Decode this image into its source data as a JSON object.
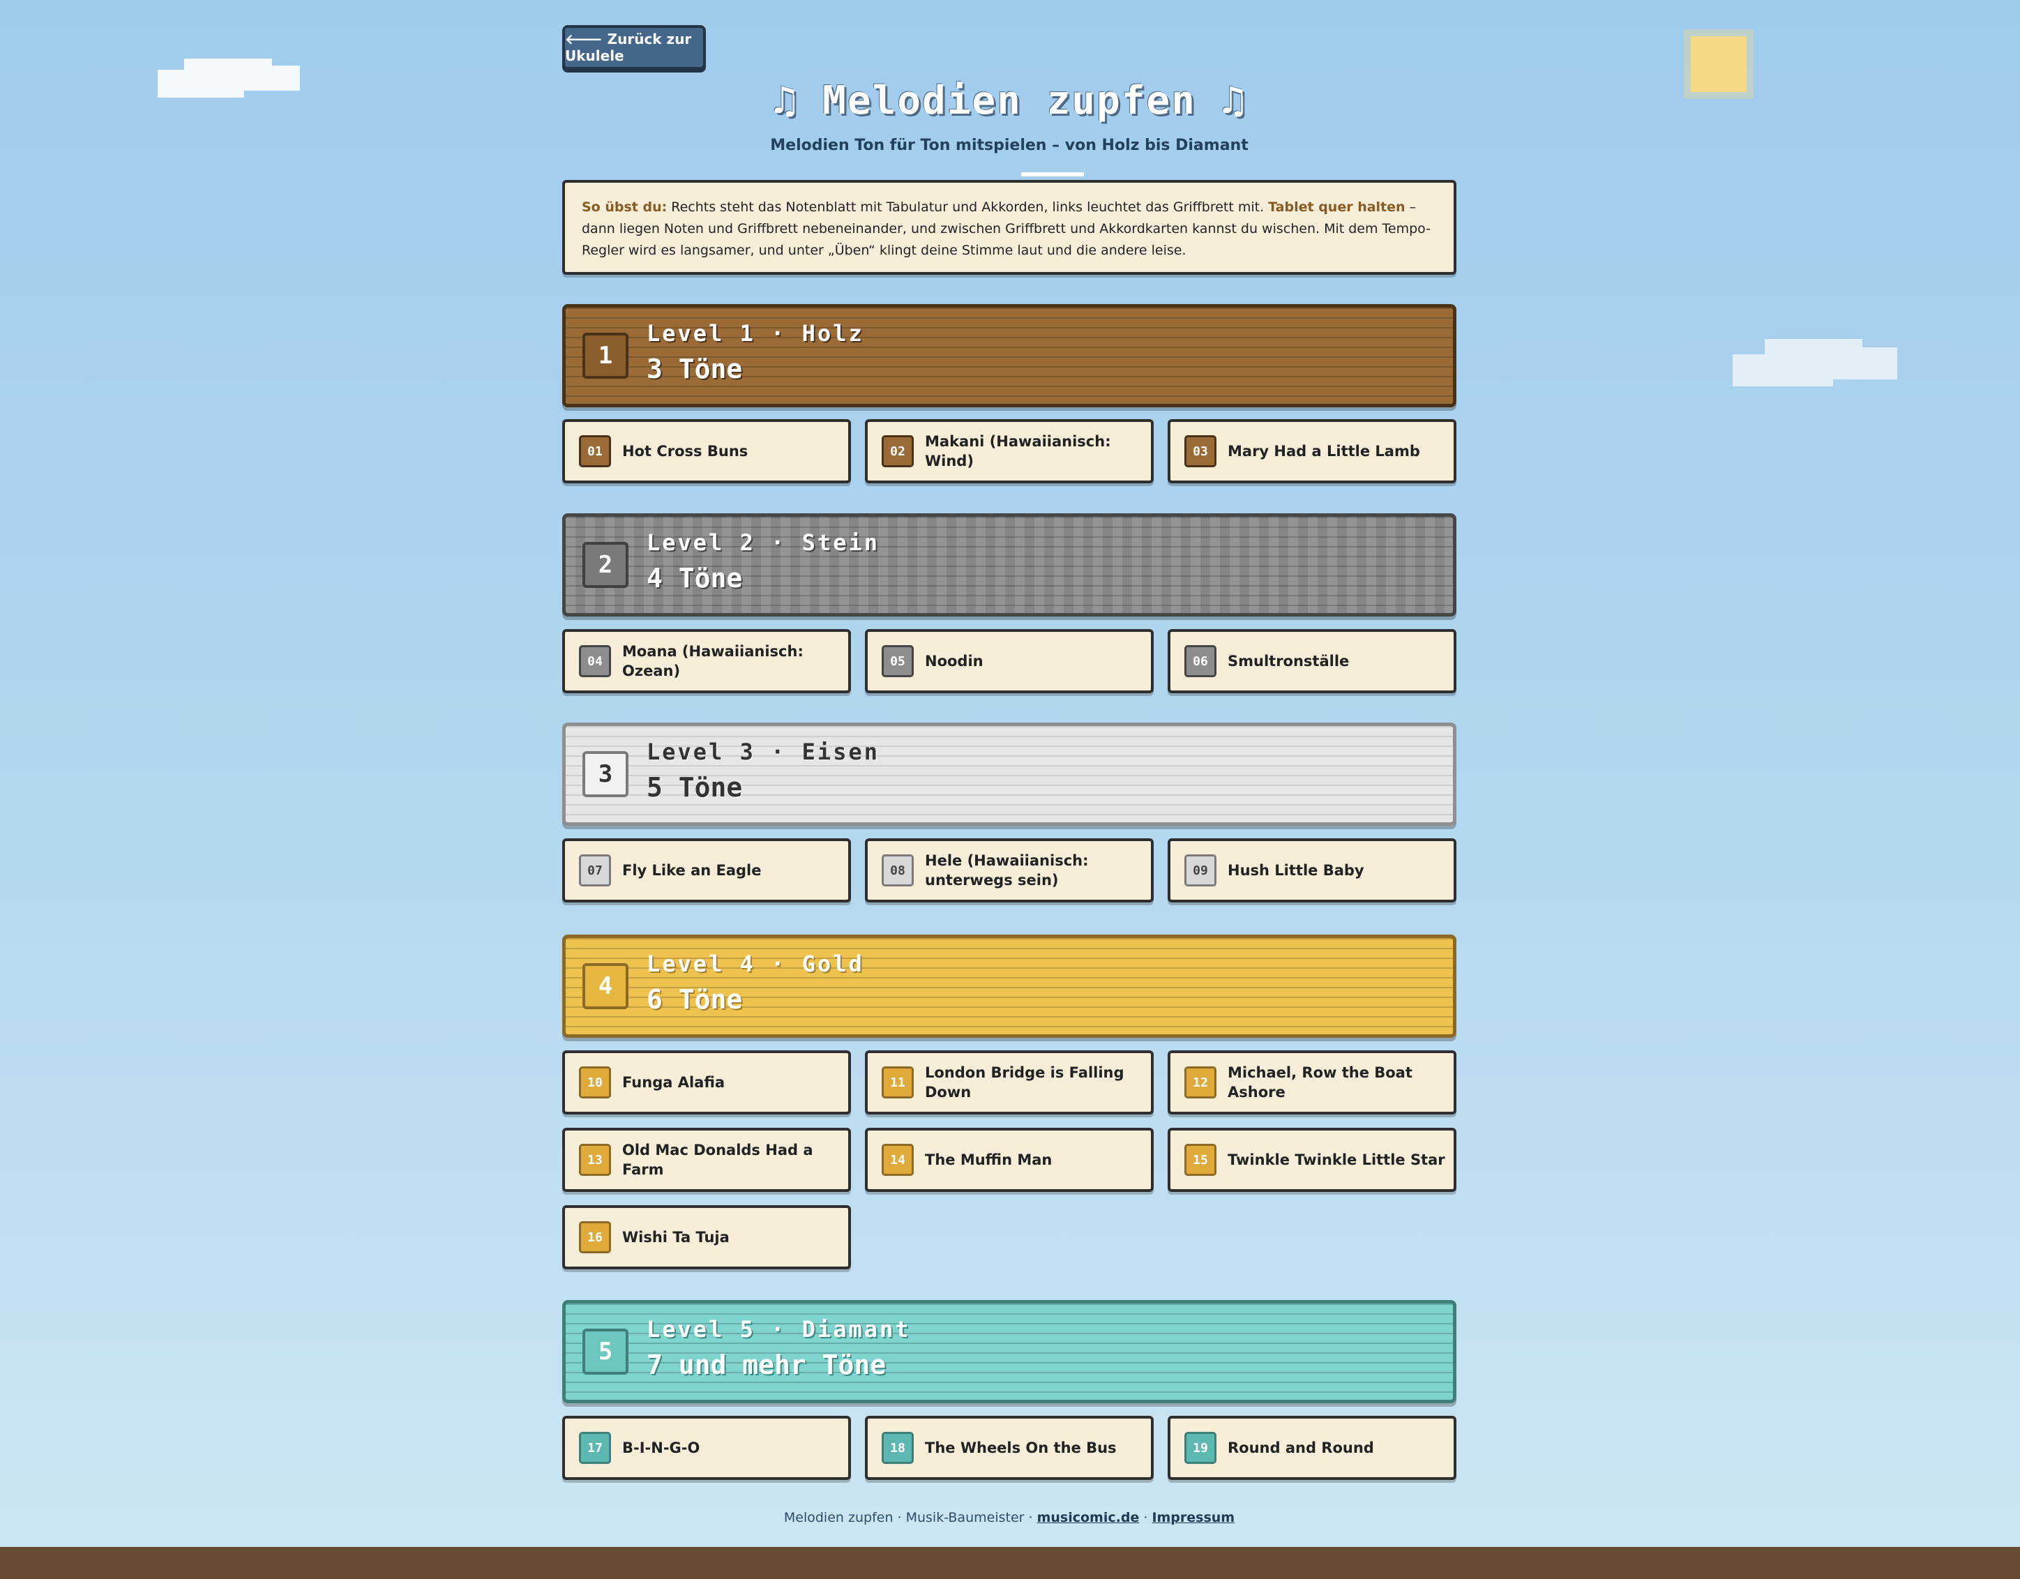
{
  "nav": {
    "back_label": "🡐 Zurück zur Ukulele"
  },
  "header": {
    "title": "♫ Melodien zupfen ♫",
    "subtitle": "Melodien Ton für Ton mitspielen – von Holz bis Diamant"
  },
  "info": {
    "lead": "So übst du:",
    "text1": " Rechts steht das Notenblatt mit Tabulatur und Akkorden, links leuchtet das Griffbrett mit. ",
    "highlight": "Tablet quer halten",
    "text2": " – dann liegen Noten und Griffbrett nebeneinander, und zwischen Griffbrett und Akkordkarten kannst du wischen. Mit dem Tempo-Regler wird es langsamer, und unter „Üben“ klingt deine Stimme laut und die andere leise."
  },
  "levels": [
    {
      "badge": "1",
      "title": "Level 1 · Holz",
      "tones": "3 Töne"
    },
    {
      "badge": "2",
      "title": "Level 2 · Stein",
      "tones": "4 Töne"
    },
    {
      "badge": "3",
      "title": "Level 3 · Eisen",
      "tones": "5 Töne"
    },
    {
      "badge": "4",
      "title": "Level 4 · Gold",
      "tones": "6 Töne"
    },
    {
      "badge": "5",
      "title": "Level 5 · Diamant",
      "tones": "7 und mehr Töne"
    }
  ],
  "songs": [
    {
      "num": "01",
      "name": "Hot Cross Buns"
    },
    {
      "num": "02",
      "name": "Makani (Hawaiianisch: Wind)"
    },
    {
      "num": "03",
      "name": "Mary Had a Little Lamb"
    },
    {
      "num": "04",
      "name": "Moana (Hawaiianisch: Ozean)"
    },
    {
      "num": "05",
      "name": "Noodin"
    },
    {
      "num": "06",
      "name": "Smultronställe"
    },
    {
      "num": "07",
      "name": "Fly Like an Eagle"
    },
    {
      "num": "08",
      "name": "Hele (Hawaiianisch: unterwegs sein)"
    },
    {
      "num": "09",
      "name": "Hush Little Baby"
    },
    {
      "num": "10",
      "name": "Funga Alafia"
    },
    {
      "num": "11",
      "name": "London Bridge is Falling Down"
    },
    {
      "num": "12",
      "name": "Michael, Row the Boat Ashore"
    },
    {
      "num": "13",
      "name": "Old Mac Donalds Had a Farm"
    },
    {
      "num": "14",
      "name": "The Muffin Man"
    },
    {
      "num": "15",
      "name": "Twinkle Twinkle Little Star"
    },
    {
      "num": "16",
      "name": "Wishi Ta Tuja"
    },
    {
      "num": "17",
      "name": "B-I-N-G-O"
    },
    {
      "num": "18",
      "name": "The Wheels On the Bus"
    },
    {
      "num": "19",
      "name": "Round and Round"
    }
  ],
  "footer": {
    "text": "Melodien zupfen · Musik-Baumeister · ",
    "link1": "musicomic.de",
    "sep": " · ",
    "link2": "Impressum"
  },
  "colors": {
    "sky_top": "#9fcbed",
    "wood": "#9a6b37",
    "stone": "#8d8d8d",
    "iron": "#e6e6e6",
    "gold": "#eec24f",
    "diamond": "#7fd4cd",
    "card": "#f6eed9"
  }
}
